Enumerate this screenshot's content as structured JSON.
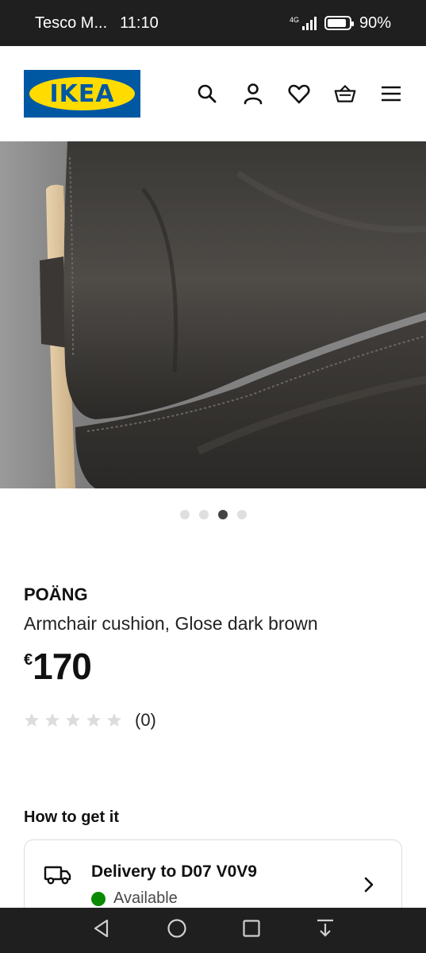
{
  "status_bar": {
    "carrier": "Tesco M...",
    "time": "11:10",
    "network": "4G",
    "battery": "90%"
  },
  "header": {
    "logo_text": "IKEA",
    "icons": [
      "search-icon",
      "account-icon",
      "favourites-icon",
      "basket-icon",
      "menu-icon"
    ]
  },
  "gallery": {
    "total": 4,
    "active_index": 2
  },
  "product": {
    "brand": "POÄNG",
    "description": "Armchair cushion, Glose dark brown",
    "currency": "€",
    "price": "170",
    "rating_stars": 0,
    "review_count": "(0)"
  },
  "availability": {
    "heading": "How to get it",
    "delivery_title": "Delivery to D07 V0V9",
    "status": "Available",
    "status_color": "#0a8a00"
  },
  "colors": {
    "ikea_blue": "#0058a3",
    "ikea_yellow": "#ffdb00"
  }
}
